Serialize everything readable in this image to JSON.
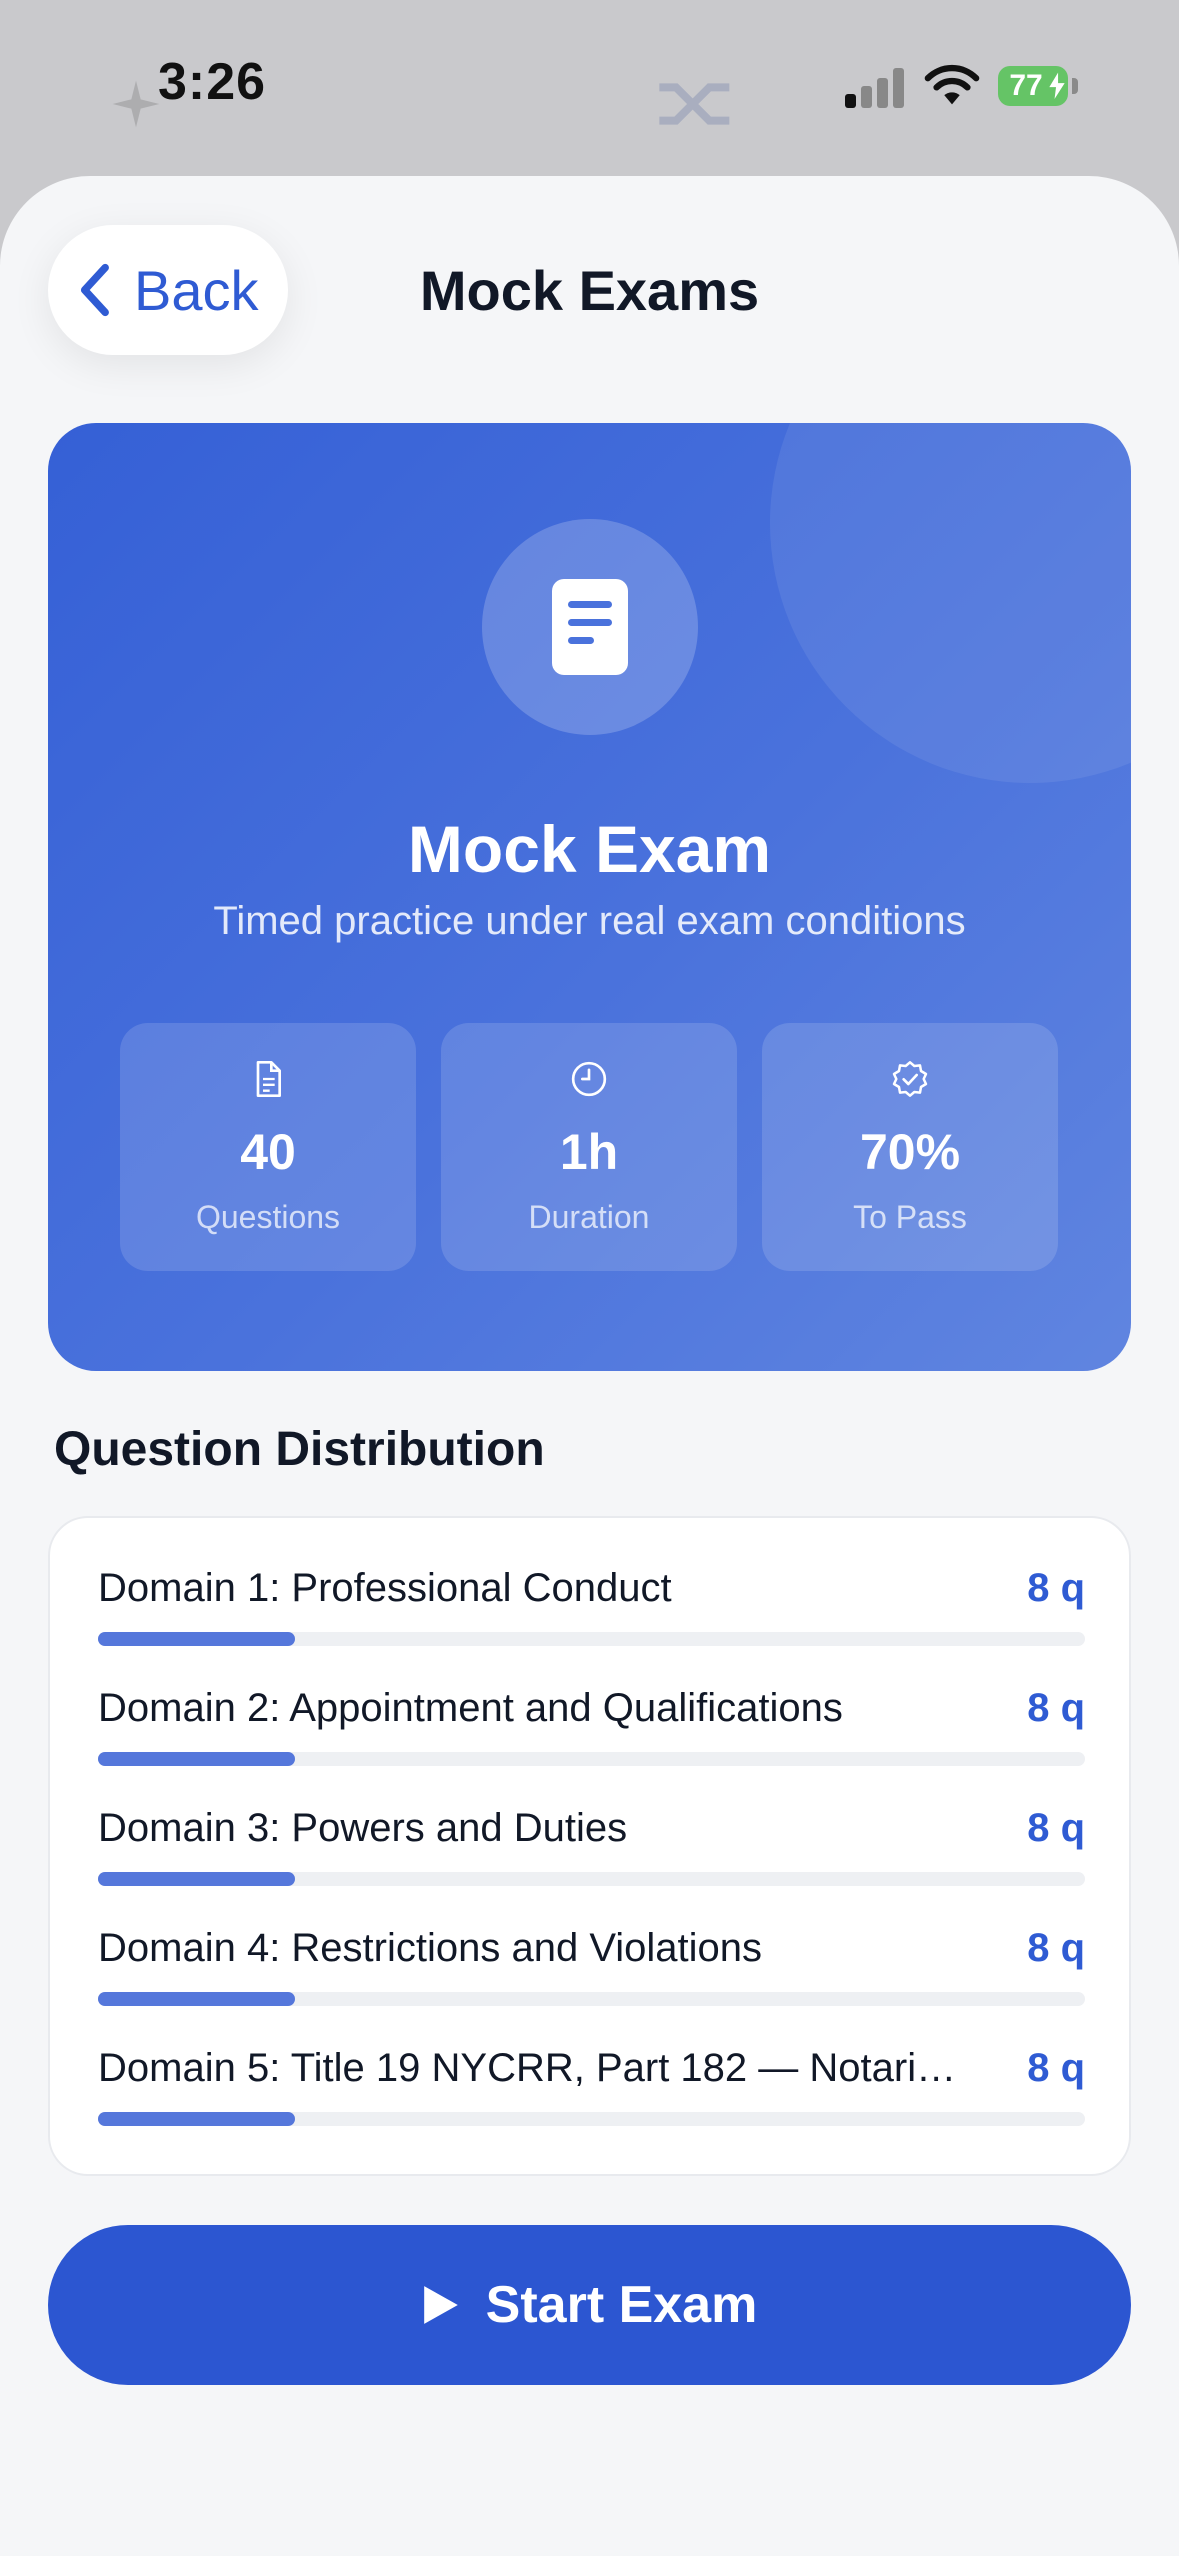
{
  "status_bar": {
    "time": "3:26",
    "battery": "77",
    "icons": [
      "cellular-signal-icon",
      "wifi-icon",
      "battery-charging-icon"
    ]
  },
  "nav": {
    "back_label": "Back",
    "title": "Mock Exams"
  },
  "hero": {
    "icon": "document-icon",
    "title": "Mock Exam",
    "subtitle": "Timed practice under real exam conditions",
    "stats": [
      {
        "icon": "file-icon",
        "value": "40",
        "label": "Questions"
      },
      {
        "icon": "clock-icon",
        "value": "1h",
        "label": "Duration"
      },
      {
        "icon": "verified-badge-icon",
        "value": "70%",
        "label": "To Pass"
      }
    ]
  },
  "distribution": {
    "title": "Question Distribution",
    "domains": [
      {
        "name": "Domain 1: Professional Conduct",
        "count": "8 q",
        "fraction": 0.2
      },
      {
        "name": "Domain 2: Appointment and Qualifications",
        "count": "8 q",
        "fraction": 0.2
      },
      {
        "name": "Domain 3: Powers and Duties",
        "count": "8 q",
        "fraction": 0.2
      },
      {
        "name": "Domain 4: Restrictions and Violations",
        "count": "8 q",
        "fraction": 0.2
      },
      {
        "name": "Domain 5: Title 19 NYCRR, Part 182 — Notari…",
        "count": "8 q",
        "fraction": 0.2
      }
    ]
  },
  "start_button": {
    "icon": "play-icon",
    "label": "Start Exam"
  },
  "colors": {
    "accent": "#2f5bd3",
    "button": "#2c56d1",
    "hero_start": "#3560d6",
    "hero_end": "#6085e0",
    "bar_fill": "#5577db",
    "background": "#f5f6f8"
  }
}
